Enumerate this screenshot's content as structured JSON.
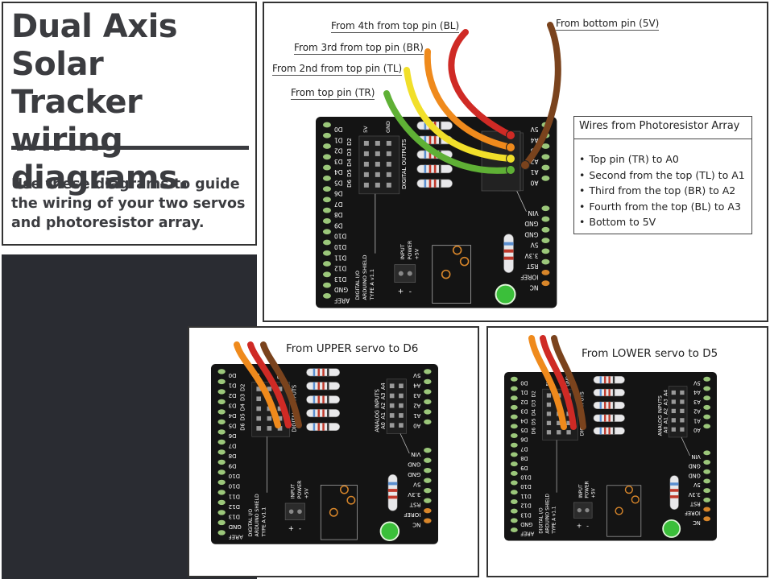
{
  "title": {
    "heading_lines": [
      "Dual Axis Solar",
      "Tracker wiring",
      "diagrams."
    ],
    "description_lines": [
      "Use these diagrams to guide",
      "the wiring of your two servos",
      "and photoresistor array."
    ]
  },
  "main_diagram": {
    "wire_labels": {
      "bl": "From 4th from top pin (BL)",
      "br": "From 3rd from top pin (BR)",
      "tl": "From 2nd from top pin (TL)",
      "tr": "From top pin  (TR)",
      "fivev": "From bottom pin (5V)"
    },
    "info_box": {
      "title": "Wires from Photoresistor Array",
      "items": [
        "Top pin (TR) to A0",
        "Second from the top (TL) to A1",
        "Third from the top (BR) to A2",
        "Fourth from the top (BL) to A3",
        "Bottom to 5V"
      ]
    }
  },
  "upper_diagram": {
    "label": "From UPPER servo to D6"
  },
  "lower_diagram": {
    "label": "From LOWER servo to D5"
  },
  "board": {
    "left_pins": [
      "D0",
      "D1",
      "D2",
      "D3",
      "D4",
      "D5",
      "D6",
      "D7",
      "D8",
      "D9",
      "D10",
      "D10",
      "D11",
      "D12",
      "D13",
      "GND",
      "AREF"
    ],
    "right_pins_top": [
      "5V",
      "A4",
      "A3",
      "A2",
      "A1",
      "A0"
    ],
    "right_pins_bottom": [
      "VIN",
      "GND",
      "GND",
      "5V",
      "3.3V",
      "RST",
      "IOREF",
      "NC"
    ],
    "digital_group": [
      "D2",
      "D3",
      "D4",
      "D5",
      "D6"
    ],
    "analog_group": [
      "A0",
      "A1",
      "A2",
      "A3",
      "A4"
    ],
    "rail_5v": "5V",
    "rail_gnd": "GND",
    "digital_outputs": "DIGITAL OUTPUTS",
    "analog_inputs": "ANALOG INPUTS",
    "shield_label": [
      "DIGITAL I/O",
      "ARDUINO SHIELD",
      "TYPE A v1.1"
    ],
    "input_power": [
      "INPUT",
      "POWER",
      "+5V"
    ],
    "plus": "+",
    "minus": "-"
  },
  "colors": {
    "board": "#141414",
    "wire_red": "#cf2a25",
    "wire_orange": "#ef8a1c",
    "wire_yellow": "#f1df2a",
    "wire_green": "#5fb035",
    "wire_brown": "#7a431d",
    "led_green": "#3bbf3a",
    "pad_orange": "#d8862a",
    "pad_green": "#9bc77a"
  }
}
